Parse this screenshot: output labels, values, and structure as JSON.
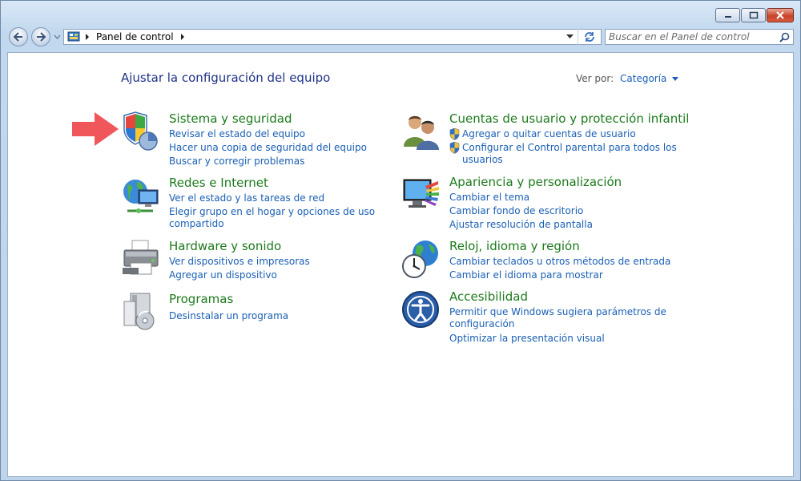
{
  "address": {
    "root": "Panel de control"
  },
  "search": {
    "placeholder": "Buscar en el Panel de control"
  },
  "page": {
    "title": "Ajustar la configuración del equipo",
    "view_by_label": "Ver por:",
    "view_by_value": "Categoría"
  },
  "categories": [
    {
      "title": "Sistema y seguridad",
      "links": [
        "Revisar el estado del equipo",
        "Hacer una copia de seguridad del equipo",
        "Buscar y corregir problemas"
      ]
    },
    {
      "title": "Redes e Internet",
      "links": [
        "Ver el estado y las tareas de red",
        "Elegir grupo en el hogar y opciones de uso",
        "compartido"
      ]
    },
    {
      "title": "Hardware y sonido",
      "links": [
        "Ver dispositivos e impresoras",
        "Agregar un dispositivo"
      ]
    },
    {
      "title": "Programas",
      "links": [
        "Desinstalar un programa"
      ]
    },
    {
      "title": "Cuentas de usuario y protección infantil",
      "links": [
        "Agregar o quitar cuentas de usuario",
        "Configurar el Control parental para todos los",
        "usuarios"
      ]
    },
    {
      "title": "Apariencia y personalización",
      "links": [
        "Cambiar el tema",
        "Cambiar fondo de escritorio",
        "Ajustar resolución de pantalla"
      ]
    },
    {
      "title": "Reloj, idioma y región",
      "links": [
        "Cambiar teclados u otros métodos de entrada",
        "Cambiar el idioma para mostrar"
      ]
    },
    {
      "title": "Accesibilidad",
      "links": [
        "Permitir que Windows sugiera parámetros de",
        "configuración",
        "Optimizar la presentación visual"
      ]
    }
  ]
}
